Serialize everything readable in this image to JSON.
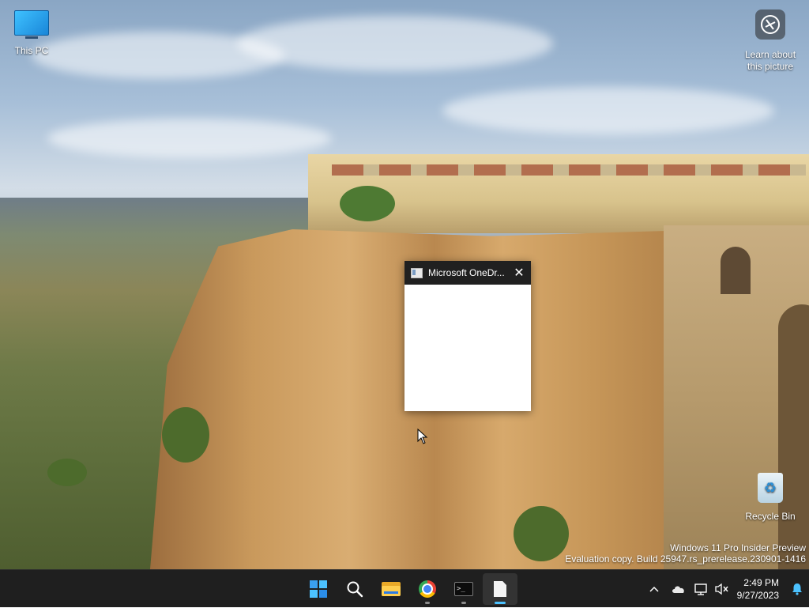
{
  "desktop": {
    "icons": [
      {
        "label": "This PC"
      },
      {
        "label": "Learn about this picture"
      },
      {
        "label": "Recycle Bin"
      }
    ],
    "watermark": {
      "line1": "Windows 11 Pro Insider Preview",
      "line2": "Evaluation copy. Build 25947.rs_prerelease.230901-1416"
    }
  },
  "window": {
    "title": "Microsoft OneDr...",
    "close_glyph": "✕"
  },
  "taskbar": {
    "apps": [
      {
        "name": "Start",
        "icon": "windows-logo-icon"
      },
      {
        "name": "Search",
        "icon": "search-icon"
      },
      {
        "name": "File Explorer",
        "icon": "folder-icon"
      },
      {
        "name": "Google Chrome",
        "icon": "chrome-icon"
      },
      {
        "name": "Terminal",
        "icon": "terminal-icon"
      },
      {
        "name": "OneDrive Setup",
        "icon": "document-icon",
        "active": true
      }
    ],
    "terminal_glyph": ">_",
    "tray": {
      "chevron": "^",
      "time": "2:49 PM",
      "date": "9/27/2023"
    }
  },
  "colors": {
    "taskbar_bg": "#1f1f1f",
    "accent": "#4cc2ff",
    "window_titlebar": "#202020"
  }
}
